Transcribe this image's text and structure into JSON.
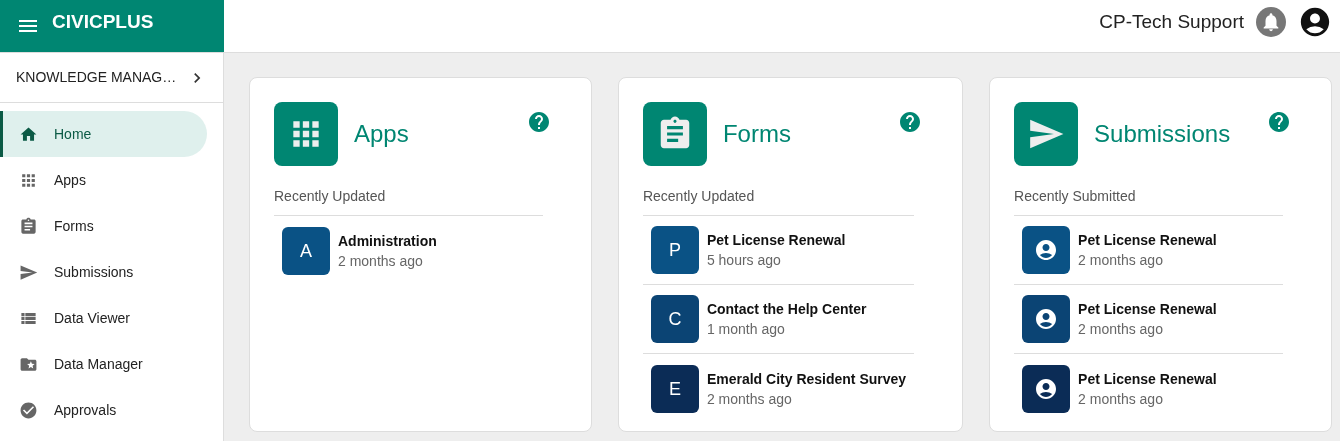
{
  "header": {
    "brand": "CIVICPLUS",
    "user": "CP-Tech Support"
  },
  "sidebar": {
    "section": "KNOWLEDGE MANAG…",
    "items": [
      {
        "label": "Home",
        "selected": true
      },
      {
        "label": "Apps",
        "selected": false
      },
      {
        "label": "Forms",
        "selected": false
      },
      {
        "label": "Submissions",
        "selected": false
      },
      {
        "label": "Data Viewer",
        "selected": false
      },
      {
        "label": "Data Manager",
        "selected": false
      },
      {
        "label": "Approvals",
        "selected": false
      }
    ]
  },
  "cards": [
    {
      "title": "Apps",
      "subtitle": "Recently Updated",
      "items": [
        {
          "kind": "letter",
          "letter": "A",
          "name": "Administration",
          "time": "2 months ago",
          "color": "#0a5285"
        }
      ]
    },
    {
      "title": "Forms",
      "subtitle": "Recently Updated",
      "items": [
        {
          "kind": "letter",
          "letter": "P",
          "name": "Pet License Renewal",
          "time": "5 hours ago",
          "color": "#0a5285"
        },
        {
          "kind": "letter",
          "letter": "C",
          "name": "Contact the Help Center",
          "time": "1 month ago",
          "color": "#0b4474"
        },
        {
          "kind": "letter",
          "letter": "E",
          "name": "Emerald City Resident Survey",
          "time": "2 months ago",
          "color": "#0b2c56"
        }
      ]
    },
    {
      "title": "Submissions",
      "subtitle": "Recently Submitted",
      "items": [
        {
          "kind": "person",
          "name": "Pet License Renewal",
          "time": "2 months ago",
          "color": "#0a5285"
        },
        {
          "kind": "person",
          "name": "Pet License Renewal",
          "time": "2 months ago",
          "color": "#0b4474"
        },
        {
          "kind": "person",
          "name": "Pet License Renewal",
          "time": "2 months ago",
          "color": "#0b2c56"
        }
      ]
    }
  ]
}
